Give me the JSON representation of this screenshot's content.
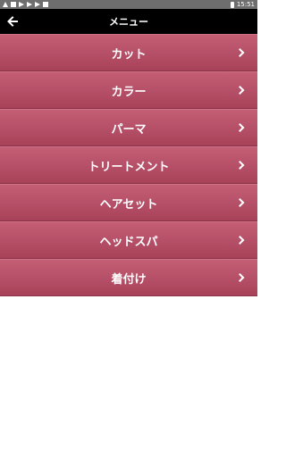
{
  "status_bar": {
    "time": "15:51",
    "icons": [
      "warning-icon",
      "image-icon",
      "play-icon",
      "play-icon",
      "play-icon",
      "shopping-bag-icon"
    ]
  },
  "toolbar": {
    "title": "メニュー",
    "back_icon": "arrow-left-icon"
  },
  "menu": {
    "items": [
      {
        "label": "カット"
      },
      {
        "label": "カラー"
      },
      {
        "label": "パーマ"
      },
      {
        "label": "トリートメント"
      },
      {
        "label": "ヘアセット"
      },
      {
        "label": "ヘッドスパ"
      },
      {
        "label": "着付け"
      }
    ]
  },
  "colors": {
    "item_background": "#b54f67",
    "toolbar_background": "#000000",
    "status_bar_background": "#6e6e6e"
  }
}
